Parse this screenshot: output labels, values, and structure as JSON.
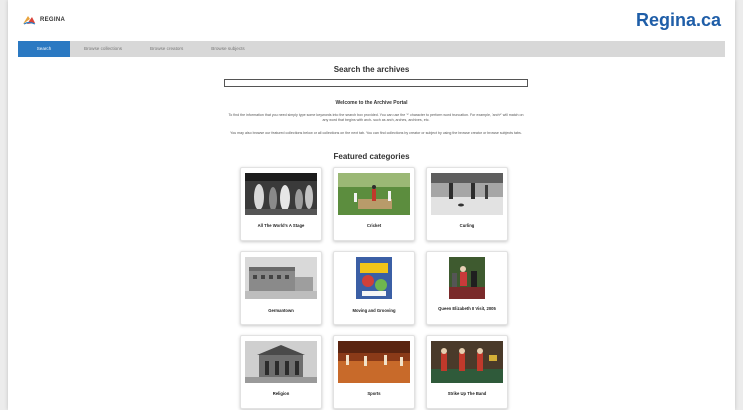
{
  "header": {
    "logo_text": "REGINA",
    "brand": "Regina.ca"
  },
  "nav": {
    "tabs": [
      {
        "label": "Search"
      },
      {
        "label": "Browse collections"
      },
      {
        "label": "Browse creators"
      },
      {
        "label": "Browse subjects"
      }
    ]
  },
  "search": {
    "title": "Search the archives",
    "value": ""
  },
  "intro": {
    "welcome": "Welcome to the Archive Portal",
    "p1": "To find the information that you need simply type some keywords into the search box provided. You can use the '*' character to perform word truncation. For example, 'arch*' will match on any word that begins with arch- such as arch, arches, archives, etc.",
    "p2": "You may also browse our featured collections below or all collections on the next tab. You can find collections by creator or subject by using the browse creator or browse subjects tabs."
  },
  "featured": {
    "title": "Featured categories",
    "items": [
      {
        "label": "All The World's A Stage",
        "photo": "theatre-photo"
      },
      {
        "label": "Cricket",
        "photo": "cricket-photo"
      },
      {
        "label": "Curling",
        "photo": "curling-photo"
      },
      {
        "label": "Germantown",
        "photo": "germantown-photo"
      },
      {
        "label": "Moving and Grooving",
        "photo": "poster-photo"
      },
      {
        "label": "Queen Elizabeth II Visit, 2005",
        "photo": "queen-visit-photo"
      },
      {
        "label": "Religion",
        "photo": "church-photo"
      },
      {
        "label": "Sports",
        "photo": "arena-photo"
      },
      {
        "label": "Strike Up The Band",
        "photo": "band-photo"
      }
    ]
  },
  "colors": {
    "brand_blue": "#1f5ea8",
    "active_tab": "#2b79c2",
    "nav_bg": "#d8d8d8"
  }
}
